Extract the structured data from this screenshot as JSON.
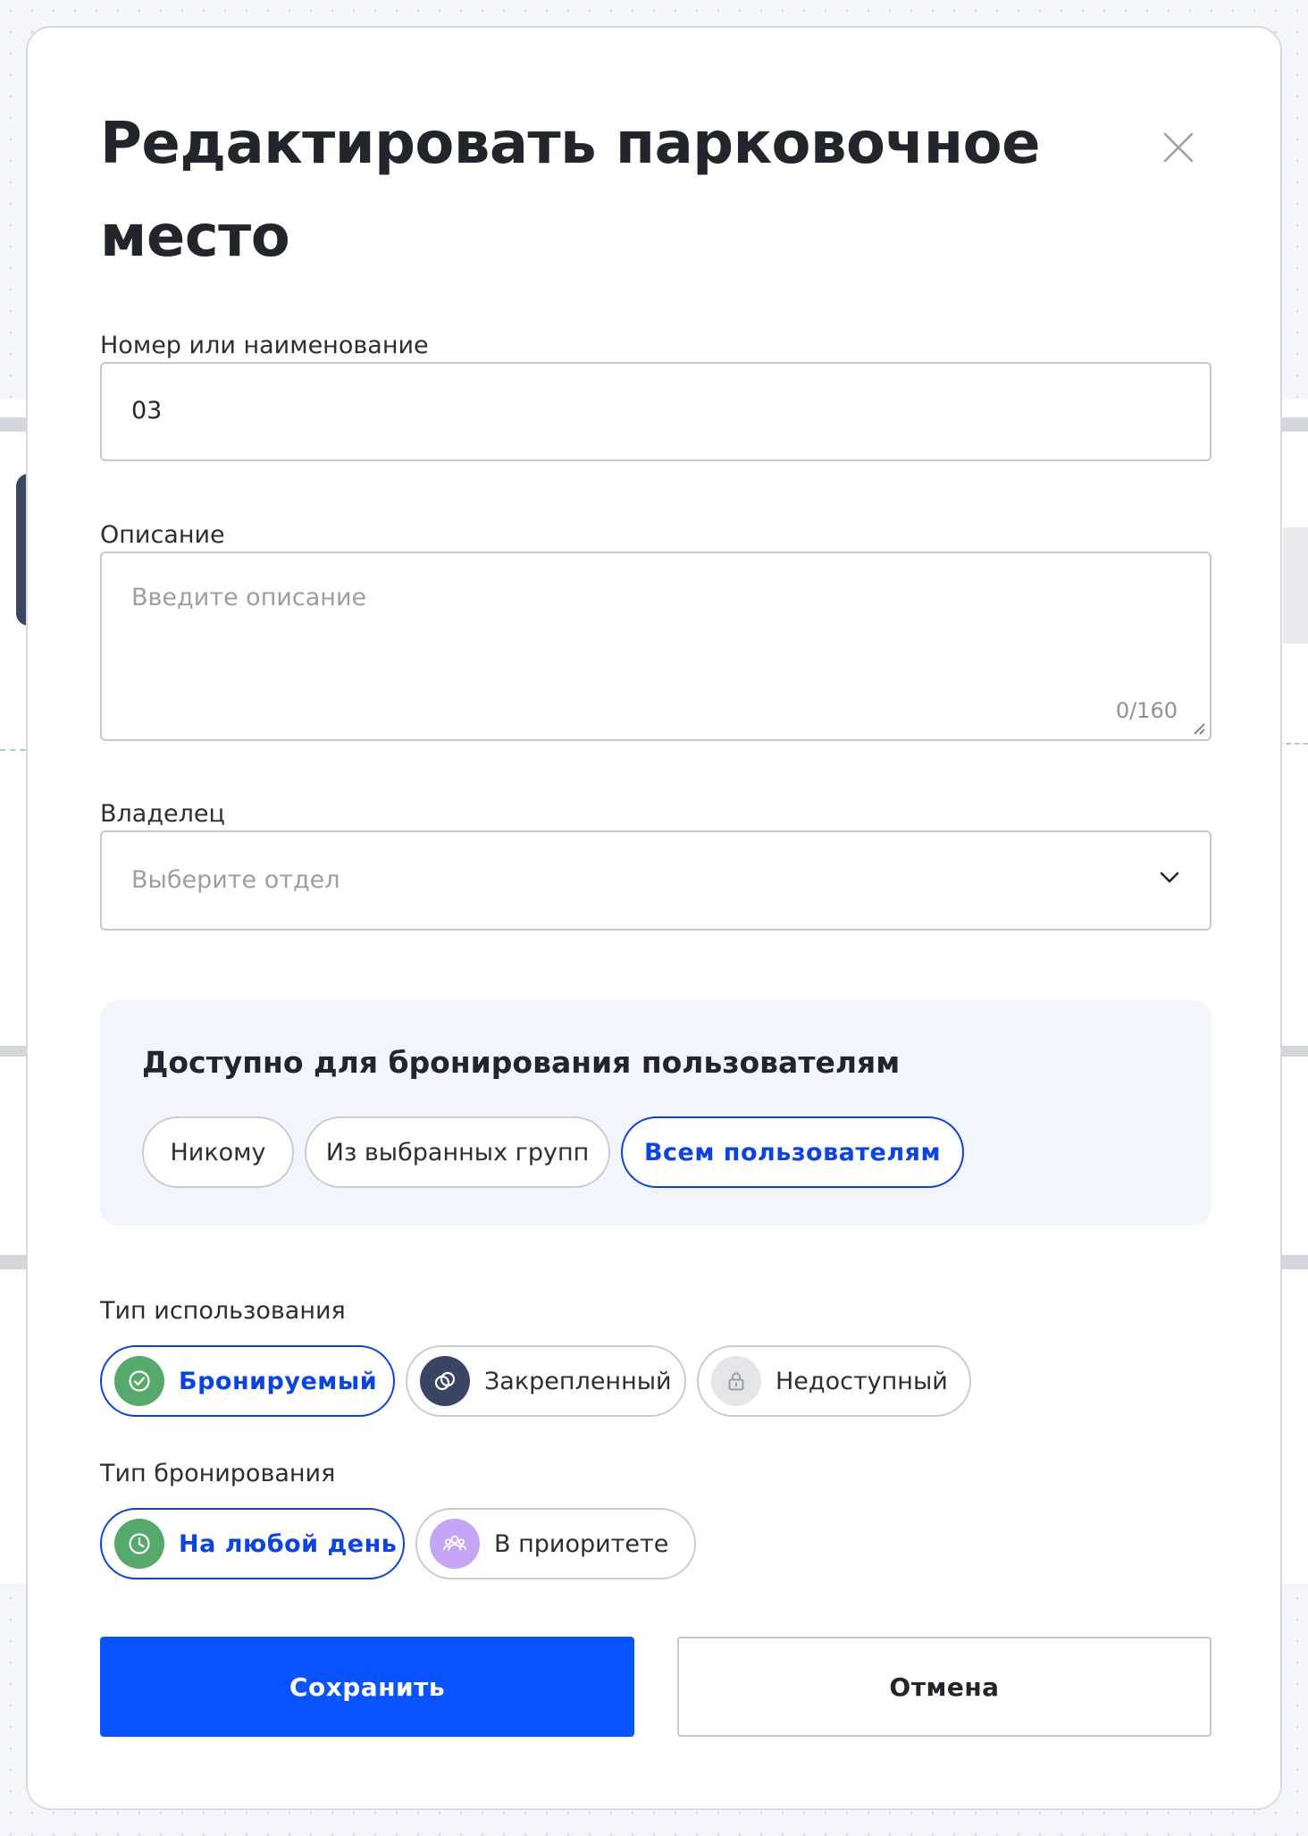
{
  "modal": {
    "title": "Редактировать парковочное место",
    "close_icon": "close-icon"
  },
  "fields": {
    "name_label": "Номер или наименование",
    "name_value": "03",
    "description_label": "Описание",
    "description_placeholder": "Введите описание",
    "description_value": "",
    "description_counter": "0/160",
    "owner_label": "Владелец",
    "owner_placeholder": "Выберите отдел"
  },
  "availability": {
    "title": "Доступно для бронирования пользователям",
    "options": [
      "Никому",
      "Из выбранных групп",
      "Всем пользователям"
    ],
    "selected": "Всем пользователям"
  },
  "usage_type": {
    "label": "Тип использования",
    "options": [
      {
        "label": "Бронируемый",
        "icon": "check-circle-icon",
        "icon_color": "#56a86b",
        "selected": true
      },
      {
        "label": "Закрепленный",
        "icon": "link-icon",
        "icon_color": "#3a4563",
        "selected": false
      },
      {
        "label": "Недоступный",
        "icon": "lock-icon",
        "icon_color": "#e4e5e8",
        "selected": false
      }
    ]
  },
  "booking_type": {
    "label": "Тип бронирования",
    "options": [
      {
        "label": "На любой день",
        "icon": "clock-icon",
        "icon_color": "#56a86b",
        "selected": true
      },
      {
        "label": "В приоритете",
        "icon": "users-icon",
        "icon_color": "#c4a6f5",
        "selected": false
      }
    ]
  },
  "actions": {
    "save_label": "Сохранить",
    "cancel_label": "Отмена"
  },
  "colors": {
    "accent": "#0a54ff",
    "selected_border": "#0b41d8",
    "section_background": "#f2f5fc"
  }
}
